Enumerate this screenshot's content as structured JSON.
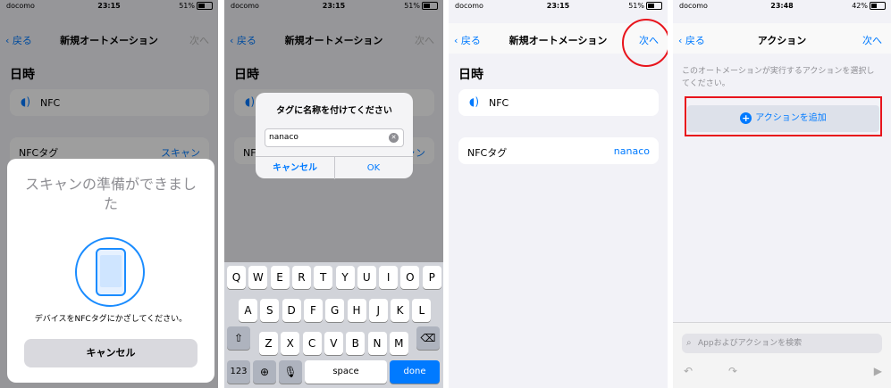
{
  "status_bars": [
    {
      "carrier": "docomo",
      "time": "23:15",
      "battery": "51%",
      "battery_level": 0.51
    },
    {
      "carrier": "docomo",
      "time": "23:15",
      "battery": "51%",
      "battery_level": 0.51
    },
    {
      "carrier": "docomo",
      "time": "23:15",
      "battery": "51%",
      "battery_level": 0.51
    },
    {
      "carrier": "docomo",
      "time": "23:48",
      "battery": "42%",
      "battery_level": 0.42
    }
  ],
  "automation_nav": {
    "back": "戻る",
    "title": "新規オートメーション",
    "next": "次へ"
  },
  "automation_form": {
    "section": "日時",
    "nfc_label": "NFC",
    "nfc_tag_label": "NFCタグ",
    "nfc_tag_scan": "スキャン",
    "nfc_tag_value": "nanaco"
  },
  "scan_sheet": {
    "heading": "スキャンの準備ができました",
    "hint": "デバイスをNFCタグにかざしてください。",
    "cancel": "キャンセル"
  },
  "name_alert": {
    "title": "タグに名称を付けてください",
    "input_value": "nanaco",
    "cancel": "キャンセル",
    "ok": "OK"
  },
  "keyboard": {
    "row1": [
      "Q",
      "W",
      "E",
      "R",
      "T",
      "Y",
      "U",
      "I",
      "O",
      "P"
    ],
    "row2": [
      "A",
      "S",
      "D",
      "F",
      "G",
      "H",
      "J",
      "K",
      "L"
    ],
    "row3": [
      "Z",
      "X",
      "C",
      "V",
      "B",
      "N",
      "M"
    ],
    "num": "123",
    "space": "space",
    "done": "done"
  },
  "actions_screen": {
    "back": "戻る",
    "title": "アクション",
    "next": "次へ",
    "description": "このオートメーションが実行するアクションを選択してください。",
    "add_action": "アクションを追加",
    "search_placeholder": "Appおよびアクションを検索"
  },
  "colors": {
    "accent": "#007aff",
    "highlight": "#e8141c"
  }
}
